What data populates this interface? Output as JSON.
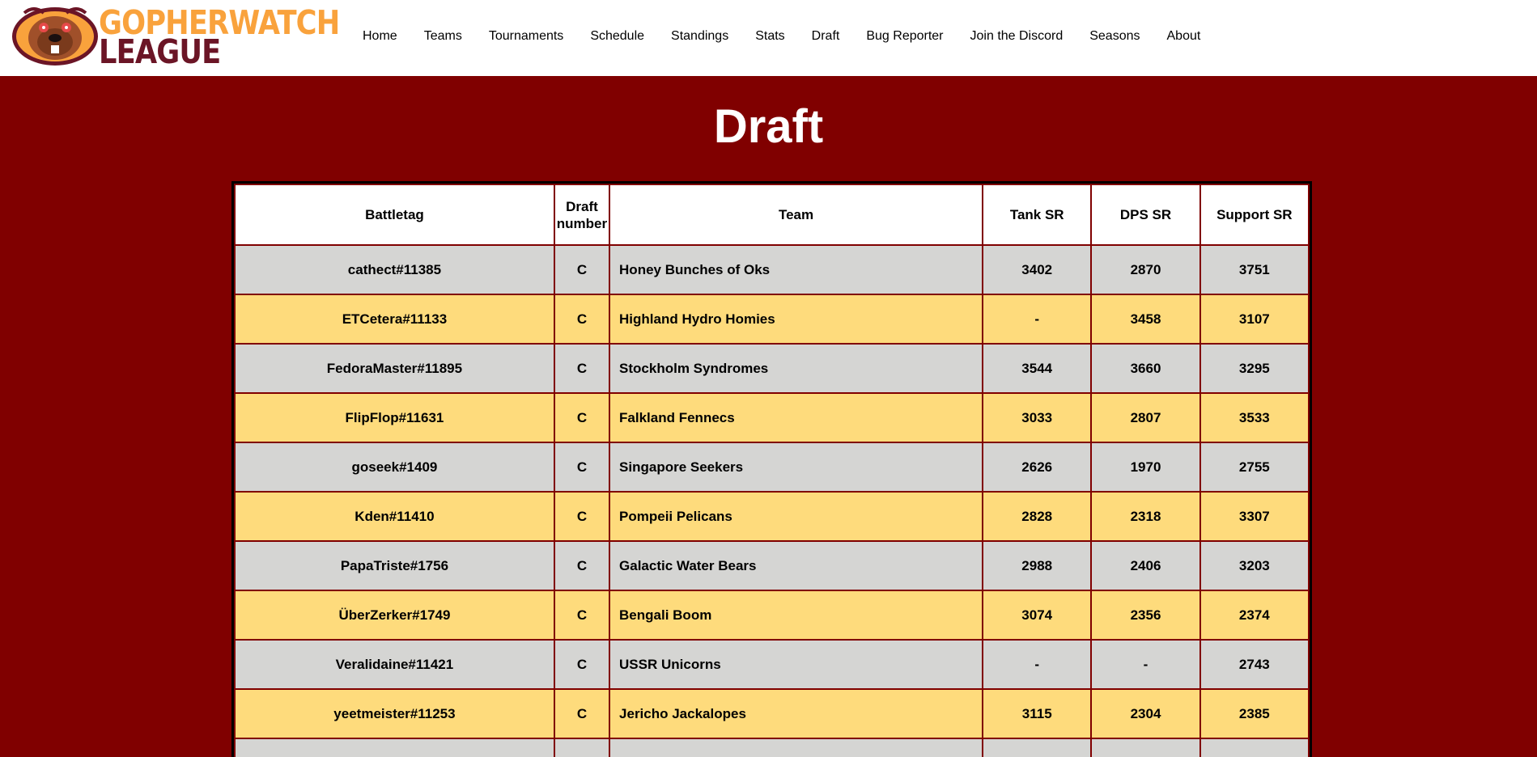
{
  "header": {
    "logo_line1": "GOPHERWATCH",
    "logo_line2": "LEAGUE",
    "nav": [
      "Home",
      "Teams",
      "Tournaments",
      "Schedule",
      "Standings",
      "Stats",
      "Draft",
      "Bug Reporter",
      "Join the Discord",
      "Seasons",
      "About"
    ]
  },
  "page": {
    "title": "Draft"
  },
  "table": {
    "headers": {
      "battletag": "Battletag",
      "draft_number": "Draft number",
      "team": "Team",
      "tank_sr": "Tank SR",
      "dps_sr": "DPS SR",
      "support_sr": "Support SR"
    },
    "rows": [
      {
        "battletag": "cathect#11385",
        "draft": "C",
        "team": "Honey Bunches of Oks",
        "tank": "3402",
        "dps": "2870",
        "support": "3751"
      },
      {
        "battletag": "ETCetera#11133",
        "draft": "C",
        "team": "Highland Hydro Homies",
        "tank": "-",
        "dps": "3458",
        "support": "3107"
      },
      {
        "battletag": "FedoraMaster#11895",
        "draft": "C",
        "team": "Stockholm Syndromes",
        "tank": "3544",
        "dps": "3660",
        "support": "3295"
      },
      {
        "battletag": "FlipFlop#11631",
        "draft": "C",
        "team": "Falkland Fennecs",
        "tank": "3033",
        "dps": "2807",
        "support": "3533"
      },
      {
        "battletag": "goseek#1409",
        "draft": "C",
        "team": "Singapore Seekers",
        "tank": "2626",
        "dps": "1970",
        "support": "2755"
      },
      {
        "battletag": "Kden#11410",
        "draft": "C",
        "team": "Pompeii Pelicans",
        "tank": "2828",
        "dps": "2318",
        "support": "3307"
      },
      {
        "battletag": "PapaTriste#1756",
        "draft": "C",
        "team": "Galactic Water Bears",
        "tank": "2988",
        "dps": "2406",
        "support": "3203"
      },
      {
        "battletag": "ÜberZerker#1749",
        "draft": "C",
        "team": "Bengali Boom",
        "tank": "3074",
        "dps": "2356",
        "support": "2374"
      },
      {
        "battletag": "Veralidaine#11421",
        "draft": "C",
        "team": "USSR Unicorns",
        "tank": "-",
        "dps": "-",
        "support": "2743"
      },
      {
        "battletag": "yeetmeister#11253",
        "draft": "C",
        "team": "Jericho Jackalopes",
        "tank": "3115",
        "dps": "2304",
        "support": "2385"
      }
    ]
  },
  "colors": {
    "background": "#800000",
    "row_gray": "#d5d5d3",
    "row_yellow": "#fedb7c",
    "logo_orange": "#f9a23c",
    "logo_maroon": "#6b1526"
  },
  "icons": {
    "logo": "gopher-mascot-icon"
  }
}
